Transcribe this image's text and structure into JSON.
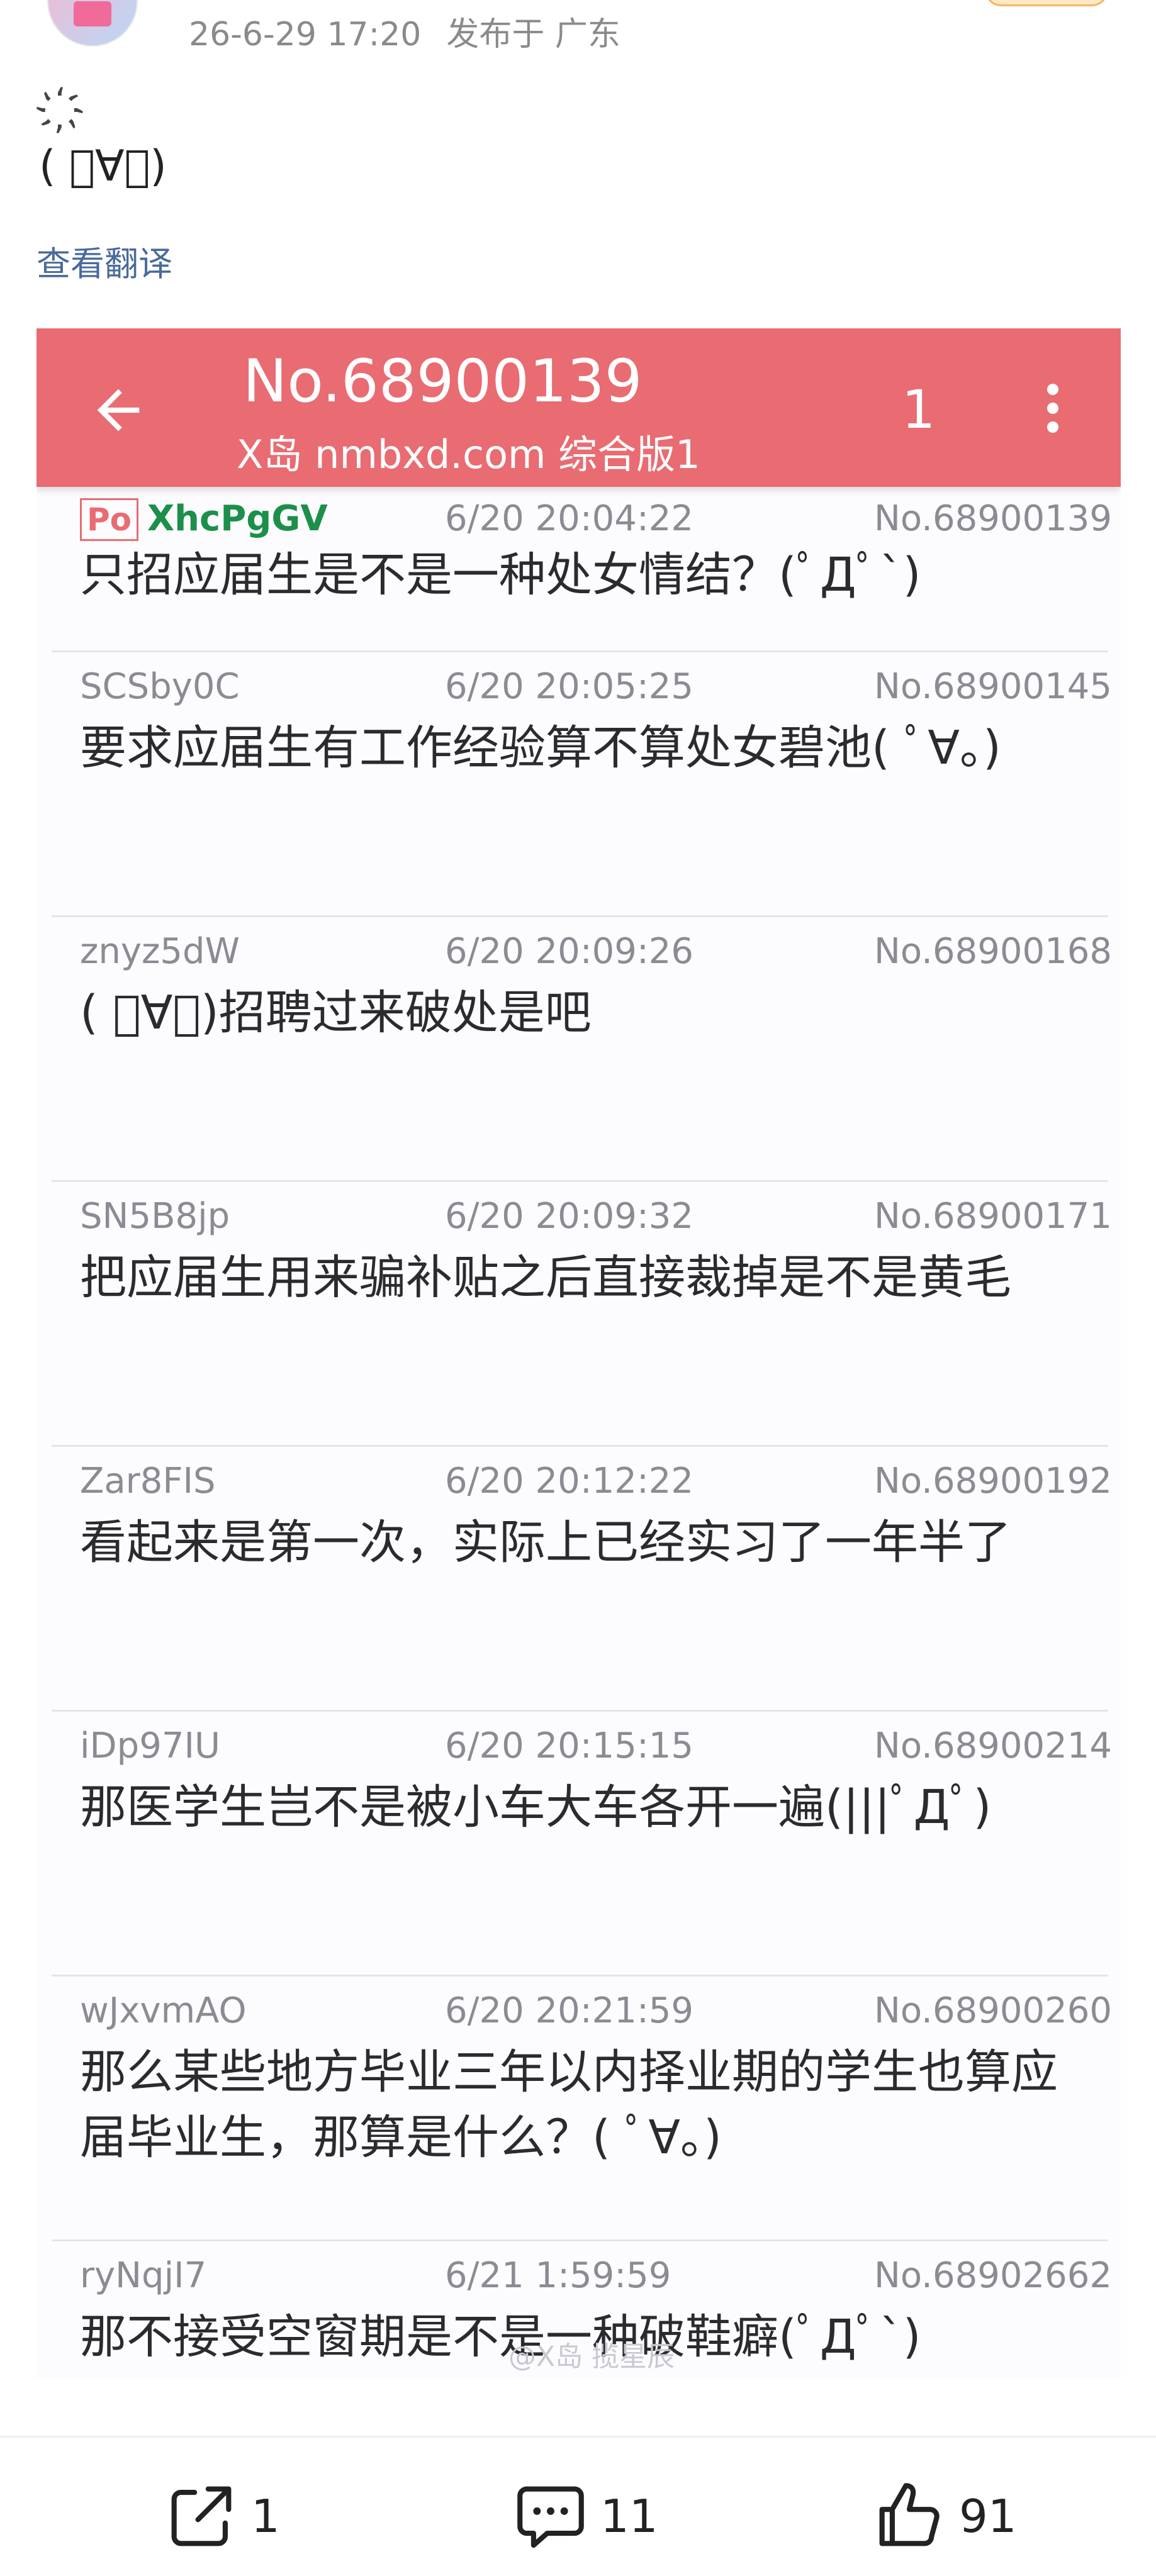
{
  "post": {
    "date": "26-6-29 17:20",
    "location": "发布于 广东",
    "sparkle": "҉",
    "text": "( ﾟ∀。)",
    "translate_link": "查看翻译"
  },
  "screenshot": {
    "thread_no": "No.68900139",
    "board": "X岛 nmbxd.com 综合版1",
    "page": "1",
    "po_badge": "Po",
    "watermark": "@X岛 揽星辰",
    "replies": [
      {
        "uid": "XhcPgGV",
        "is_po": true,
        "time": "6/20 20:04:22",
        "no": "No.68900139",
        "content": "只招应届生是不是一种处女情结？(ﾟДﾟ`)"
      },
      {
        "uid": "SCSby0C",
        "time": "6/20 20:05:25",
        "no": "No.68900145",
        "content": "要求应届生有工作经验算不算处女碧池( ﾟ∀。)"
      },
      {
        "uid": "znyz5dW",
        "time": "6/20 20:09:26",
        "no": "No.68900168",
        "content": "( ﾟ∀。)招聘过来破处是吧"
      },
      {
        "uid": "SN5B8jp",
        "time": "6/20 20:09:32",
        "no": "No.68900171",
        "content": "把应届生用来骗补贴之后直接裁掉是不是黄毛"
      },
      {
        "uid": "Zar8FIS",
        "time": "6/20 20:12:22",
        "no": "No.68900192",
        "content": "看起来是第一次，实际上已经实习了一年半了"
      },
      {
        "uid": "iDp97IU",
        "time": "6/20 20:15:15",
        "no": "No.68900214",
        "content": "那医学生岂不是被小车大车各开一遍(|||ﾟДﾟ)"
      },
      {
        "uid": "wJxvmAO",
        "time": "6/20 20:21:59",
        "no": "No.68900260",
        "content": "那么某些地方毕业三年以内择业期的学生也算应届毕业生，那算是什么？( ﾟ∀。)"
      },
      {
        "uid": "ryNqjI7",
        "time": "6/21 1:59:59",
        "no": "No.68902662",
        "content": "那不接受空窗期是不是一种破鞋癖(ﾟДﾟ`)"
      }
    ]
  },
  "actions": {
    "share_count": "1",
    "comment_count": "11",
    "like_count": "91"
  },
  "colors": {
    "app_bar": "#e86c72",
    "po_uid": "#1c8f4a",
    "link": "#4a6a9c"
  },
  "icons": [
    "back-arrow-icon",
    "more-vert-icon",
    "share-icon",
    "comment-icon",
    "like-icon"
  ]
}
